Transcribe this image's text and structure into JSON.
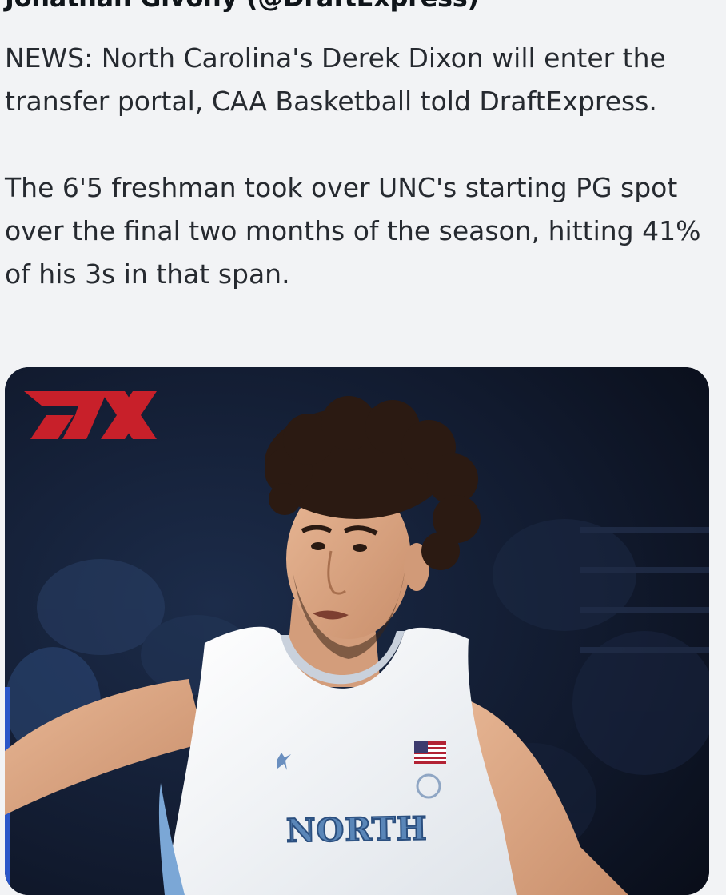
{
  "author": {
    "display": "Jonathan Givony (@DraftExpress)"
  },
  "tweet": {
    "paragraphs": [
      "NEWS: North Carolina's Derek Dixon will enter the transfer portal, CAA Basketball told DraftExpress.",
      "The 6'5 freshman took over UNC's starting PG spot over the final two months of the season, hitting 41% of his 3s in that span."
    ]
  },
  "media": {
    "logo": "DX",
    "jersey_text": "NORTH",
    "colors": {
      "logo_red": "#c8202a",
      "jersey": "#f3f5f8",
      "carolina_blue": "#7ba7d6"
    }
  }
}
